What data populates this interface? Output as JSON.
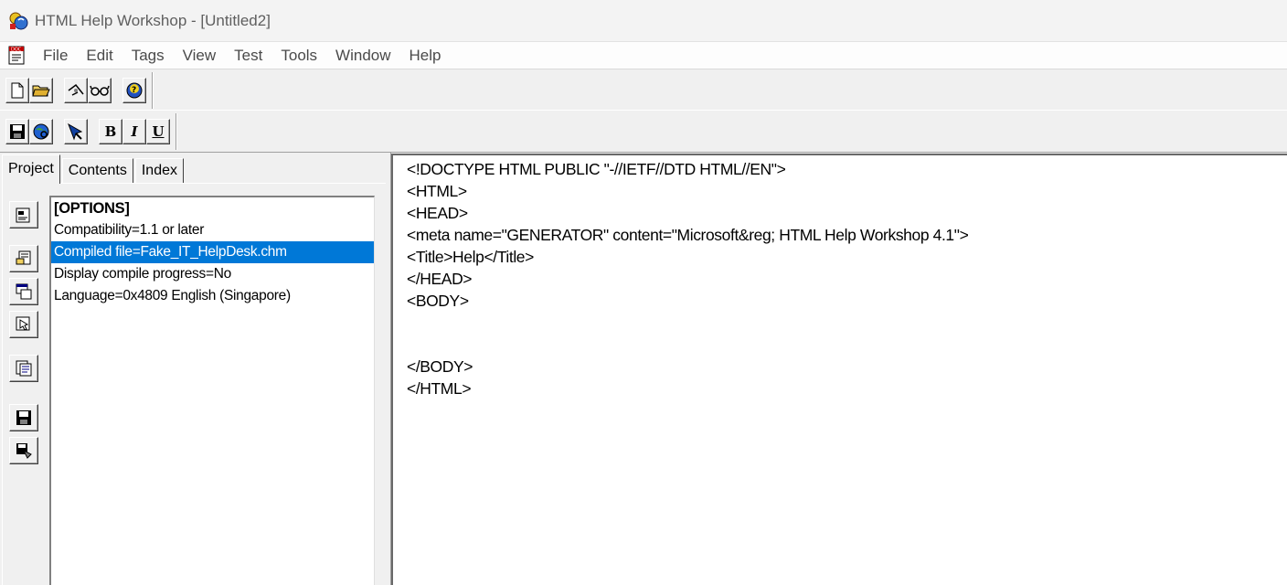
{
  "window": {
    "title": "HTML Help Workshop - [Untitled2]"
  },
  "menu": [
    "File",
    "Edit",
    "Tags",
    "View",
    "Test",
    "Tools",
    "Window",
    "Help"
  ],
  "toolbar": {
    "row1_icons": [
      "new-file-icon",
      "open-folder-icon",
      "compile-icon",
      "view-compiled-icon",
      "help-icon"
    ],
    "row2_icons": [
      "save-icon",
      "browser-view-icon",
      "jump-icon"
    ],
    "format_buttons": {
      "bold": "B",
      "italic": "I",
      "underline": "U"
    }
  },
  "tabs": [
    "Project",
    "Contents",
    "Index"
  ],
  "active_tab": "Project",
  "side_icons": [
    "change-options-icon",
    "add-file-icon",
    "add-window-icon",
    "api-map-icon",
    "html-files-icon",
    "save-project-icon",
    "save-compile-icon"
  ],
  "options": [
    "[OPTIONS]",
    "Compatibility=1.1 or later",
    "Compiled file=Fake_IT_HelpDesk.chm",
    "Display compile progress=No",
    "Language=0x4809 English (Singapore)"
  ],
  "selected_option_index": 2,
  "editor_lines": [
    "<!DOCTYPE HTML PUBLIC \"-//IETF//DTD HTML//EN\">",
    "<HTML>",
    "<HEAD>",
    "<meta name=\"GENERATOR\" content=\"Microsoft&reg; HTML Help Workshop 4.1\">",
    "<Title>Help</Title>",
    "</HEAD>",
    "<BODY>",
    "",
    "",
    "</BODY>",
    "</HTML>"
  ],
  "colors": {
    "selection": "#0078d7",
    "chrome": "#f0f0f0"
  }
}
